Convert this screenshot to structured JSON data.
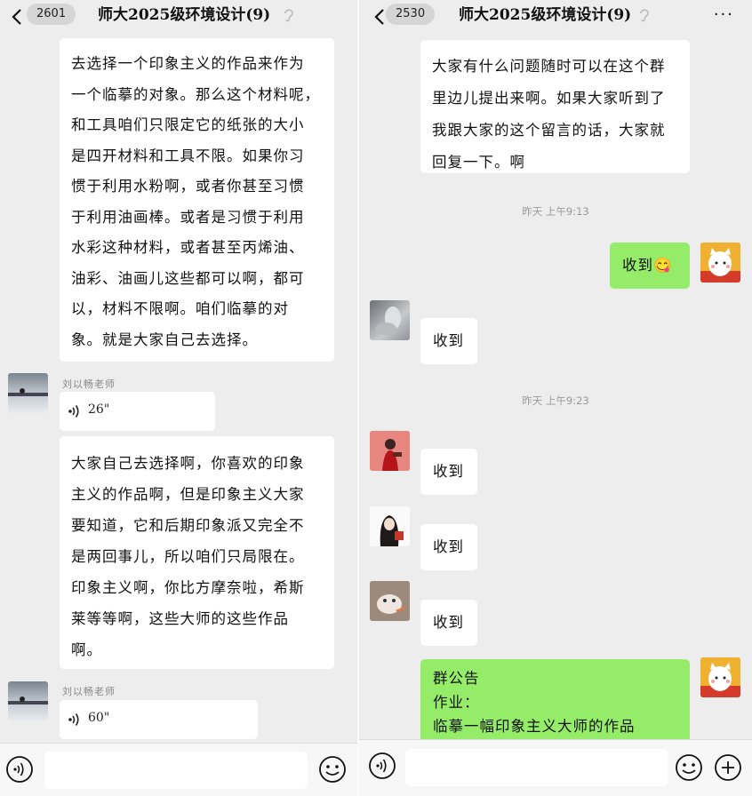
{
  "left": {
    "header": {
      "badge": "2601",
      "title": "师大2025级环境设计(9)"
    },
    "messages": [
      {
        "text": "去选择一个印象主义的作品来作为\n一个临摹的对象。那么这个材料呢，\n和工具咱们只限定它的纸张的大小\n是四开材料和工具不限。如果你习\n惯于利用水粉啊，或者你甚至习惯\n于利用油画棒。或者是习惯于利用\n水彩这种材料，或者甚至丙烯油、\n油彩、油画儿这些都可以啊，都可\n以，材料不限啊。咱们临摹的对\n象。就是大家自己去选择。"
      },
      {
        "sender": "刘以畅老师",
        "voice_duration": "26\""
      },
      {
        "text": "大家自己去选择啊，你喜欢的印象\n主义的作品啊，但是印象主义大家\n要知道，它和后期印象派又完全不\n是两回事儿，所以咱们只局限在。\n印象主义啊，你比方摩奈啦，希斯\n莱等等啊，这些大师的这些作品\n啊。"
      },
      {
        "sender": "刘以畅老师",
        "voice_duration": "60\""
      }
    ]
  },
  "right": {
    "header": {
      "badge": "2530",
      "title": "师大2025级环境设计(9)",
      "more": "···"
    },
    "messages": [
      {
        "text": "大家有什么问题随时可以在这个群\n里边儿提出来啊。如果大家听到了\n我跟大家的这个留言的话，大家就\n回复一下。啊"
      },
      {
        "timestamp": "昨天 上午9:13"
      },
      {
        "text": "收到",
        "emoji": "😋",
        "self": true
      },
      {
        "text": "收到"
      },
      {
        "timestamp": "昨天 上午9:23"
      },
      {
        "text": "收到"
      },
      {
        "text": "收到"
      },
      {
        "text": "收到"
      },
      {
        "announcement_title": "群公告",
        "announcement_lines": [
          "作业：",
          "临摹一幅印象主义大师的作品"
        ]
      }
    ]
  },
  "colors": {
    "green_bubble": "#95ec69",
    "background": "#ededed"
  }
}
